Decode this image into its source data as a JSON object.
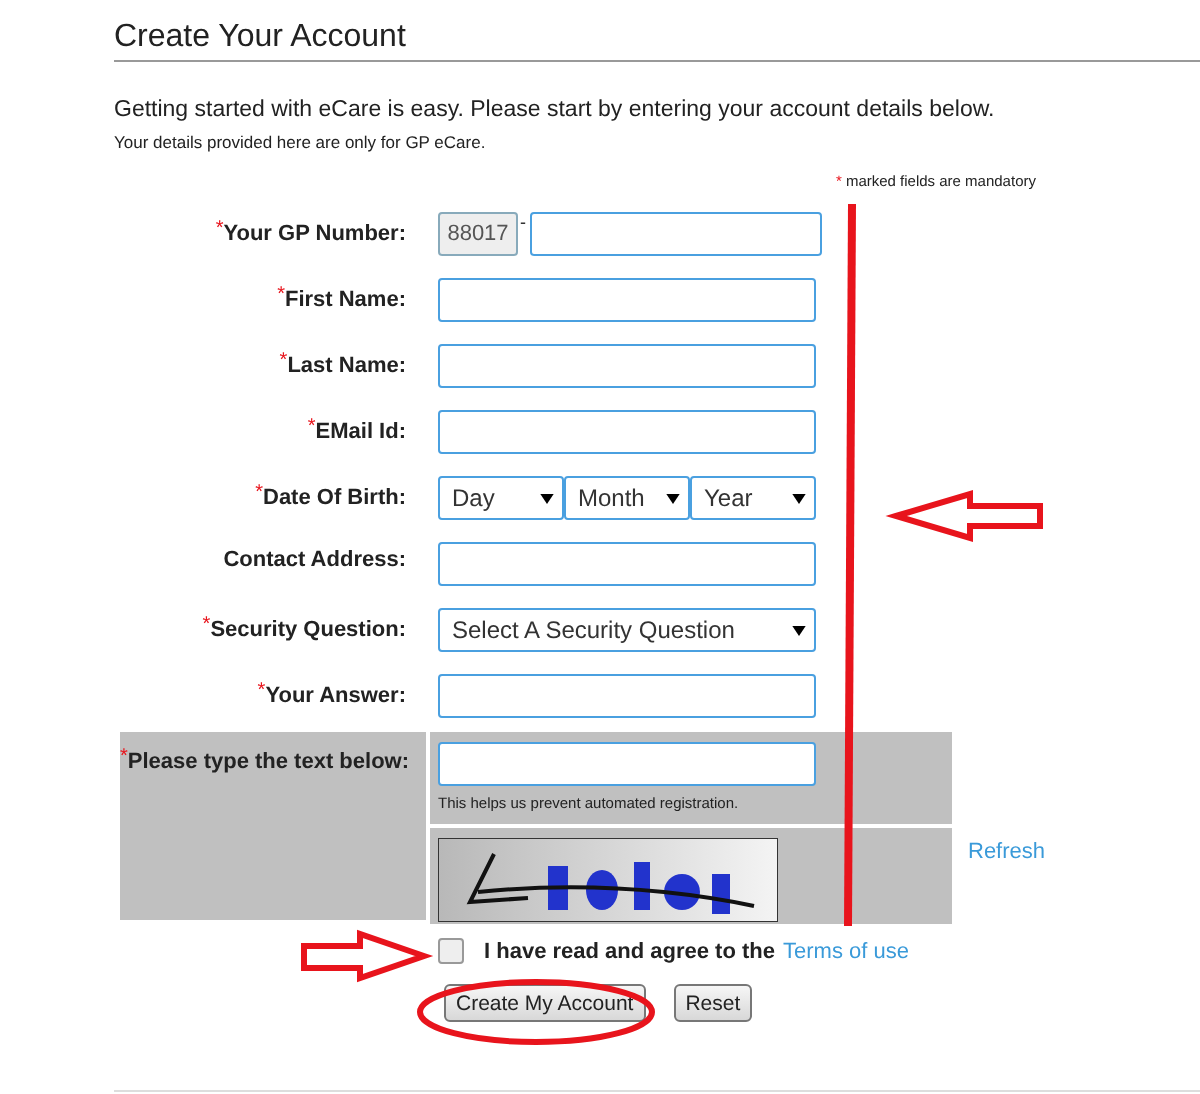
{
  "title": "Create Your Account",
  "intro": "Getting started with eCare is easy. Please start by entering your account details below.",
  "note": "Your details provided here are only for GP eCare.",
  "mandatory_note": {
    "mark": "*",
    "text": "marked fields are mandatory"
  },
  "fields": [
    {
      "kind": "prefixed",
      "label": "Your GP Number:",
      "required": true,
      "prefix": "88017",
      "separator": "-"
    },
    {
      "kind": "text",
      "label": "First Name:",
      "required": true
    },
    {
      "kind": "text",
      "label": "Last Name:",
      "required": true
    },
    {
      "kind": "text",
      "label": "EMail Id:",
      "required": true
    },
    {
      "kind": "date",
      "label": "Date Of Birth:",
      "required": true,
      "selects": [
        "Day",
        "Month",
        "Year"
      ]
    },
    {
      "kind": "text",
      "label": "Contact Address:",
      "required": false
    },
    {
      "kind": "select",
      "label": "Security Question:",
      "required": true,
      "value": "Select A Security Question"
    },
    {
      "kind": "text",
      "label": "Your Answer:",
      "required": true
    }
  ],
  "captcha": {
    "label": "Please type the text below:",
    "required": true,
    "hint": "This helps us prevent automated registration.",
    "refresh": "Refresh"
  },
  "terms": {
    "checked": false,
    "text": "I have read and agree to the",
    "link": "Terms of use"
  },
  "buttons": [
    "Create My Account",
    "Reset"
  ]
}
